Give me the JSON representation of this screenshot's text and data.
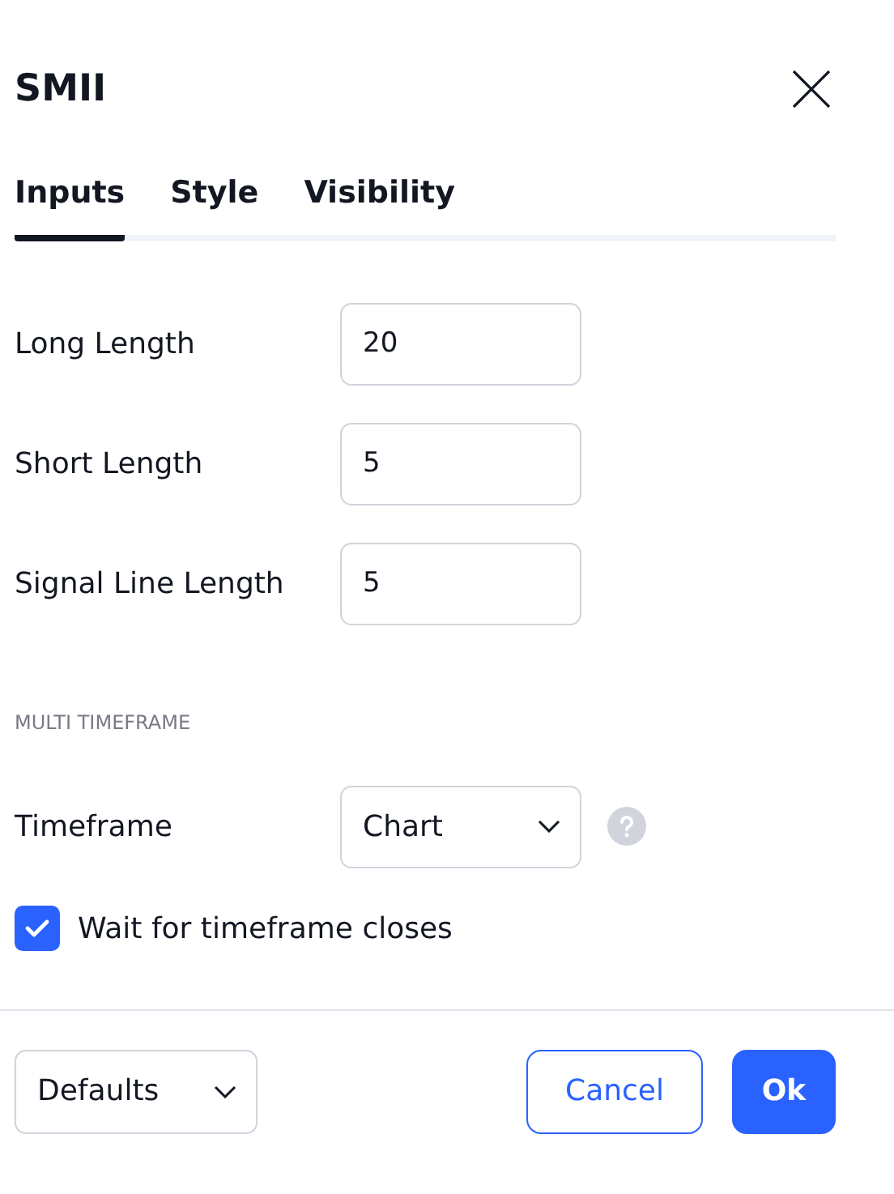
{
  "dialog": {
    "title": "SMII"
  },
  "tabs": [
    {
      "label": "Inputs",
      "selected": true
    },
    {
      "label": "Style",
      "selected": false
    },
    {
      "label": "Visibility",
      "selected": false
    }
  ],
  "inputs": [
    {
      "kind": "number",
      "label": "Long Length",
      "value": "20"
    },
    {
      "kind": "number",
      "label": "Short Length",
      "value": "5"
    },
    {
      "kind": "number",
      "label": "Signal Line Length",
      "value": "5"
    }
  ],
  "section": {
    "heading": "MULTI TIMEFRAME",
    "rows": [
      {
        "kind": "select",
        "label": "Timeframe",
        "value": "Chart",
        "help": true
      },
      {
        "kind": "checkbox",
        "label": "Wait for timeframe closes",
        "checked": true
      }
    ]
  },
  "footer": {
    "defaults": "Defaults",
    "cancel": "Cancel",
    "ok": "Ok"
  }
}
